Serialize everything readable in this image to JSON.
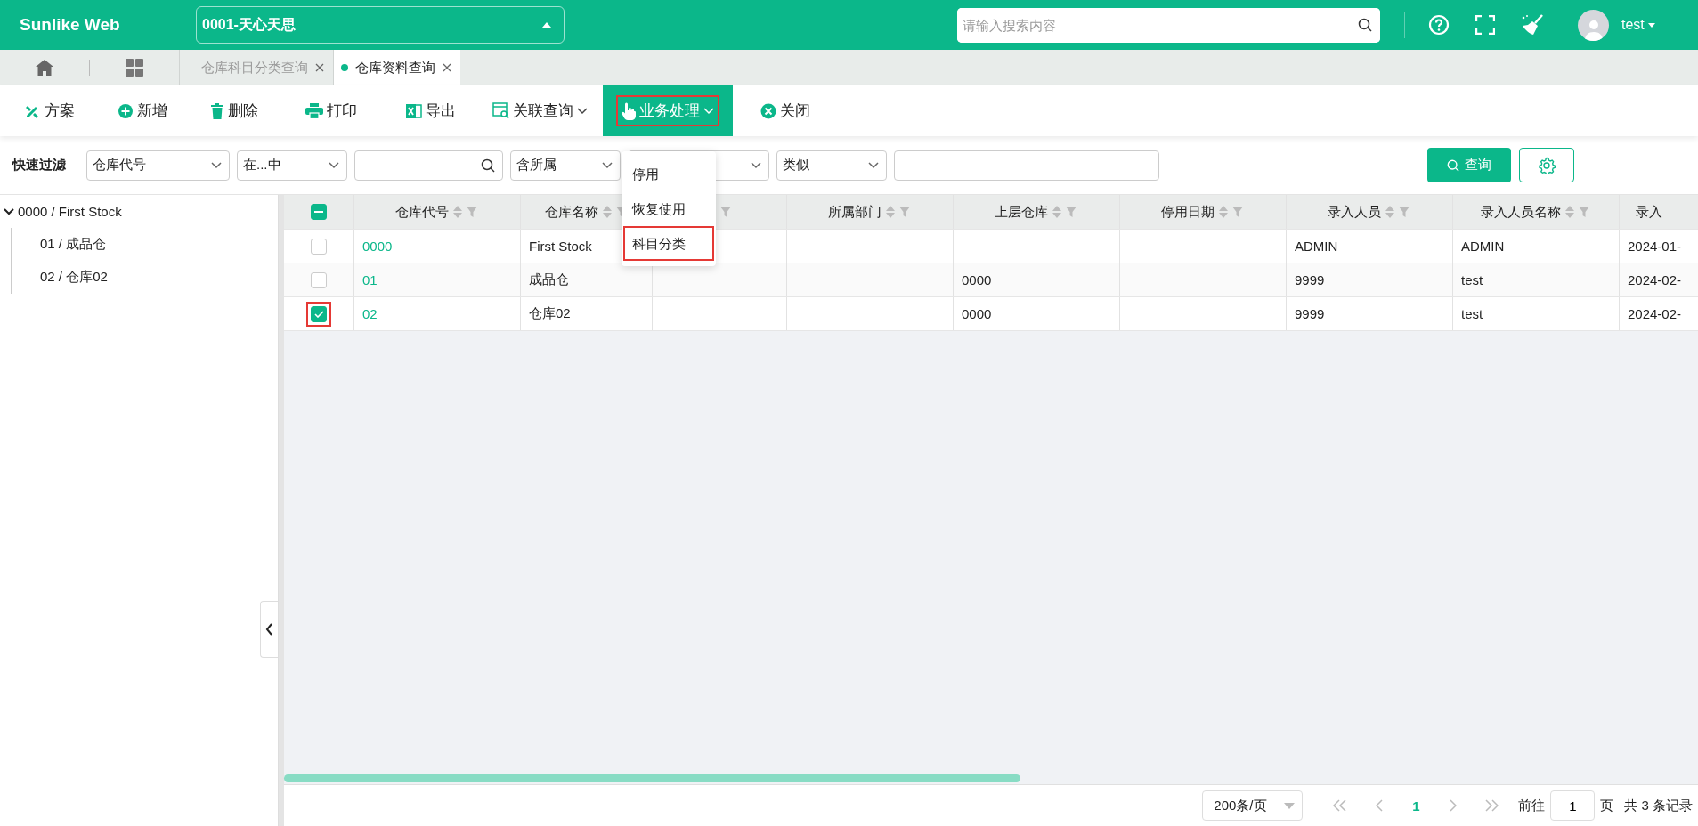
{
  "app": {
    "logo": "Sunlike Web",
    "company": "0001-天心天思",
    "search": {
      "placeholder": "请输入搜索内容"
    },
    "user": "test"
  },
  "tabs": [
    {
      "label": "仓库科目分类查询",
      "selected": false
    },
    {
      "label": "仓库资料查询",
      "selected": true
    }
  ],
  "toolbar": [
    {
      "label": "方案",
      "kind": "scheme",
      "has_menu": false,
      "selected": false,
      "highlighted": false
    },
    {
      "label": "新增",
      "kind": "add",
      "has_menu": false,
      "selected": false,
      "highlighted": false
    },
    {
      "label": "删除",
      "kind": "delete",
      "has_menu": false,
      "selected": false,
      "highlighted": false
    },
    {
      "label": "打印",
      "kind": "print",
      "has_menu": false,
      "selected": false,
      "highlighted": false
    },
    {
      "label": "导出",
      "kind": "export",
      "has_menu": false,
      "selected": false,
      "highlighted": false
    },
    {
      "label": "关联查询",
      "kind": "related",
      "has_menu": true,
      "selected": false,
      "highlighted": false
    },
    {
      "label": "业务处理",
      "kind": "business",
      "has_menu": true,
      "selected": true,
      "highlighted": true
    },
    {
      "label": "关闭",
      "kind": "close",
      "has_menu": false,
      "selected": false,
      "highlighted": false
    }
  ],
  "menu": {
    "items": [
      {
        "label": "停用",
        "highlighted": false
      },
      {
        "label": "恢复使用",
        "highlighted": false
      },
      {
        "label": "科目分类",
        "highlighted": true
      }
    ]
  },
  "filter": {
    "label": "快速过滤",
    "controls": [
      {
        "kind": "select",
        "value": "仓库代号"
      },
      {
        "kind": "select",
        "value": "在...中"
      },
      {
        "kind": "search"
      },
      {
        "kind": "select",
        "value": "含所属"
      },
      {
        "kind": "select"
      },
      {
        "kind": "select",
        "value": "类似"
      },
      {
        "kind": "input"
      }
    ],
    "query_button": "查询"
  },
  "tree": [
    {
      "label": "0000 / First Stock",
      "expanded": true,
      "children": [
        {
          "label": "01 / 成品仓"
        },
        {
          "label": "02 / 仓库02"
        }
      ]
    }
  ],
  "table": {
    "select_all_partial": true,
    "columns": [
      {
        "label": "仓库代号",
        "sortable": true,
        "kind": "link"
      },
      {
        "label": "仓库名称",
        "sortable": true,
        "kind": "text"
      },
      {
        "sortable": true,
        "kind": "text"
      },
      {
        "label": "所属部门",
        "sortable": true,
        "kind": "text"
      },
      {
        "label": "上层仓库",
        "sortable": true,
        "kind": "text"
      },
      {
        "label": "停用日期",
        "sortable": true,
        "kind": "text"
      },
      {
        "label": "录入人员",
        "sortable": true,
        "kind": "text"
      },
      {
        "label": "录入人员名称",
        "sortable": true,
        "kind": "text"
      },
      {
        "label": "录入",
        "sortable": false,
        "kind": "text"
      }
    ],
    "rows": [
      {
        "selected": false,
        "highlighted": false,
        "cells": [
          "0000",
          "First Stock",
          null,
          null,
          null,
          null,
          "ADMIN",
          "ADMIN",
          "2024-01-"
        ]
      },
      {
        "selected": false,
        "highlighted": false,
        "cells": [
          "01",
          "成品仓",
          null,
          null,
          "0000",
          null,
          "9999",
          "test",
          "2024-02-"
        ]
      },
      {
        "selected": true,
        "highlighted": true,
        "cells": [
          "02",
          "仓库02",
          null,
          null,
          "0000",
          null,
          "9999",
          "test",
          "2024-02-"
        ]
      }
    ]
  },
  "pagination": {
    "page_size": "200条/页",
    "current": "1",
    "goto_label": "前往",
    "goto_value": "1",
    "page_unit": "页",
    "total": "共 3 条记录"
  }
}
